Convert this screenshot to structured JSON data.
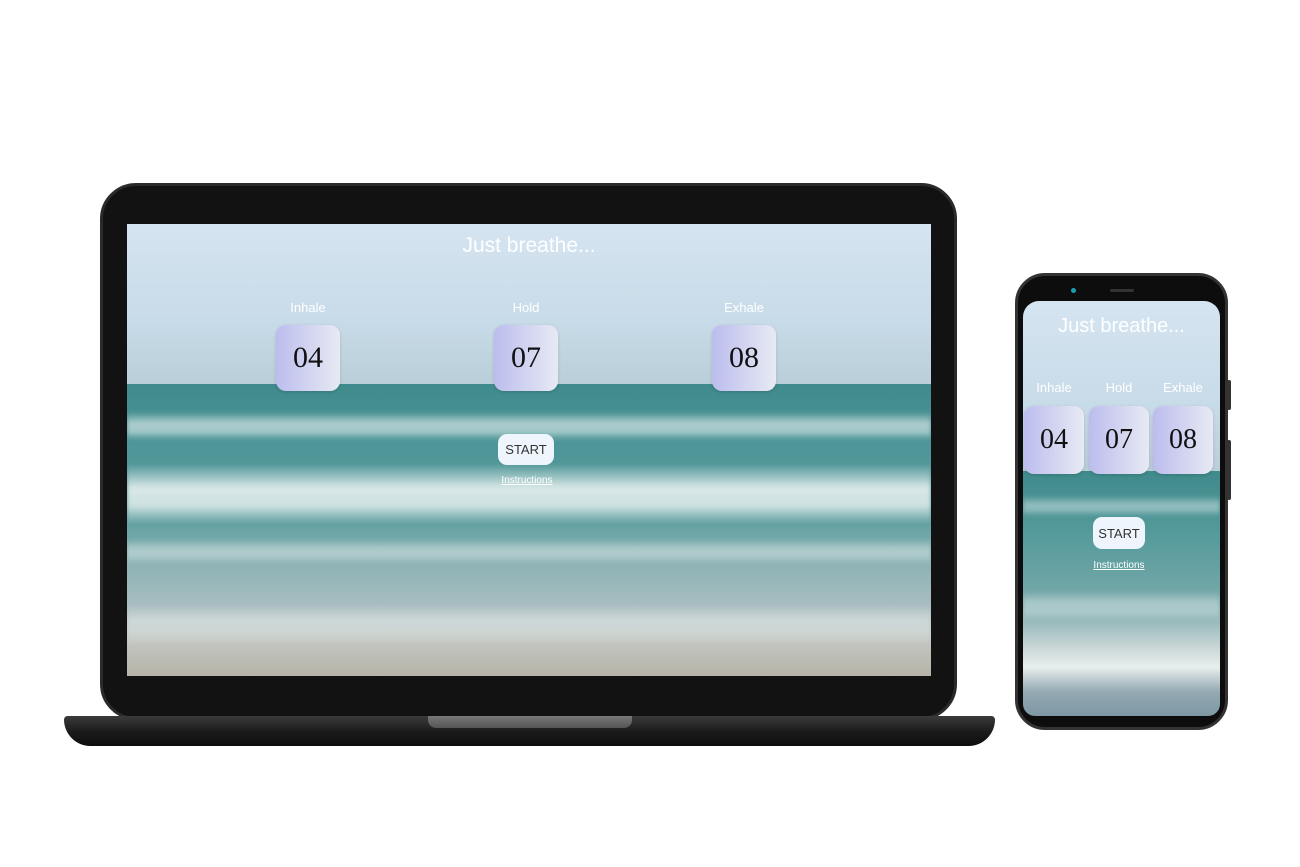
{
  "app": {
    "title": "Just breathe...",
    "start_label": "START",
    "instructions_label": "Instructions"
  },
  "phases": [
    {
      "label": "Inhale",
      "value": "04"
    },
    {
      "label": "Hold",
      "value": "07"
    },
    {
      "label": "Exhale",
      "value": "08"
    }
  ],
  "colors": {
    "box_gradient_start": "#bcbdee",
    "box_gradient_end": "#e7eaf3",
    "button_bg": "#eef5fd"
  }
}
